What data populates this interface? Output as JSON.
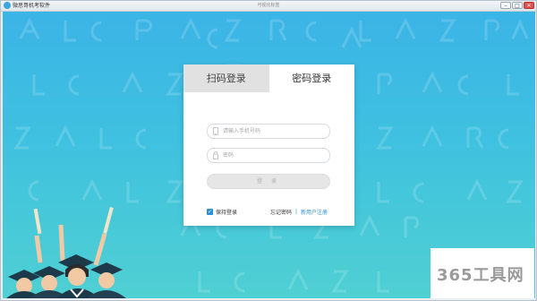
{
  "window": {
    "app_title": "微思哥机考软件",
    "caption": "可视化标签",
    "buttons": [
      "–",
      "□",
      "✕"
    ]
  },
  "login": {
    "tab_qr": "扫码登录",
    "tab_password": "密码登录",
    "phone_placeholder": "请输入手机号码",
    "password_placeholder": "密码",
    "login_button": "登 录",
    "remember_label": "保持登录",
    "forgot_label": "忘记密码",
    "separator": "|",
    "register_label": "新用户注册"
  },
  "watermark": {
    "text": "365工具网"
  },
  "colors": {
    "accent": "#2d8fd6",
    "background_top": "#3bb4e6",
    "background_bottom": "#4fd0d2"
  },
  "icons": [
    "app-logo-icon",
    "phone-icon",
    "lock-icon",
    "checkbox-checked-icon",
    "graduates-illustration"
  ]
}
